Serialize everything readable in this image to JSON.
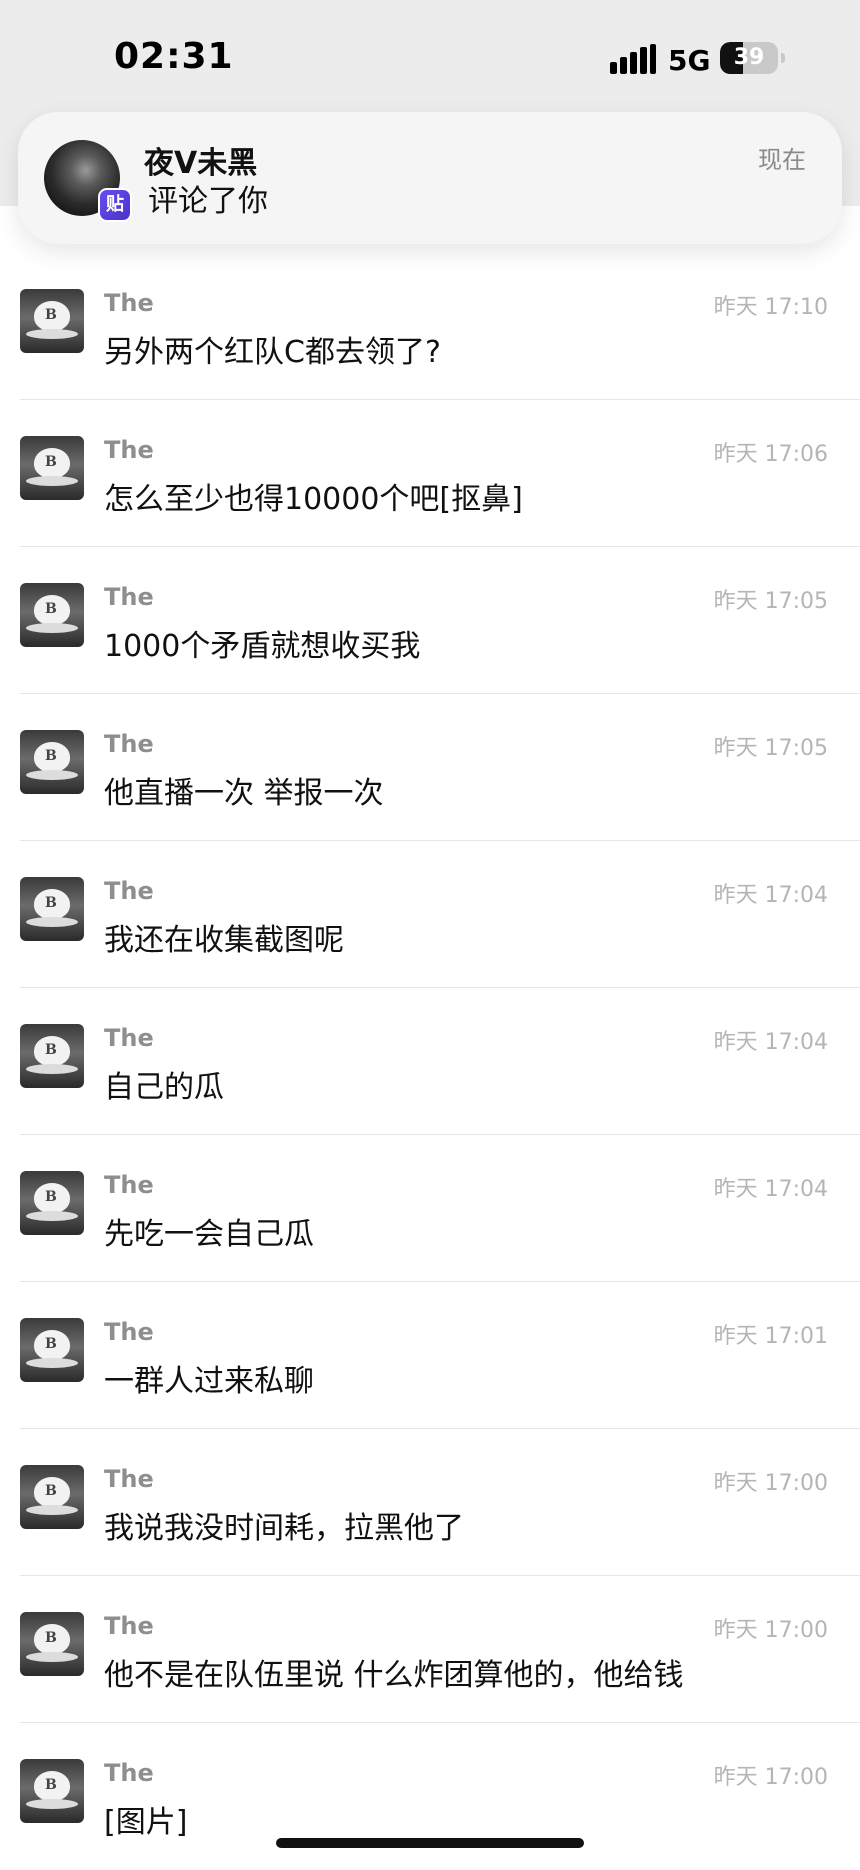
{
  "status_bar": {
    "time": "02:31",
    "network": "5G",
    "battery": "39",
    "battery_level": 0.39,
    "icons": [
      "signal-icon",
      "battery-icon"
    ]
  },
  "notification": {
    "title": "夜Ⅴ未黑",
    "body": "评论了你",
    "time": "现在",
    "app_badge": "贴"
  },
  "messages": [
    {
      "name": "The",
      "time": "昨天 17:10",
      "text": "另外两个红队C都去领了?"
    },
    {
      "name": "The",
      "time": "昨天 17:06",
      "text": "怎么至少也得10000个吧[抠鼻]"
    },
    {
      "name": "The",
      "time": "昨天 17:05",
      "text": "1000个矛盾就想收买我"
    },
    {
      "name": "The",
      "time": "昨天 17:05",
      "text": "他直播一次 举报一次"
    },
    {
      "name": "The",
      "time": "昨天 17:04",
      "text": "我还在收集截图呢"
    },
    {
      "name": "The",
      "time": "昨天 17:04",
      "text": "自己的瓜"
    },
    {
      "name": "The",
      "time": "昨天 17:04",
      "text": "先吃一会自己瓜"
    },
    {
      "name": "The",
      "time": "昨天 17:01",
      "text": "一群人过来私聊"
    },
    {
      "name": "The",
      "time": "昨天 17:00",
      "text": "我说我没时间耗，拉黑他了"
    },
    {
      "name": "The",
      "time": "昨天 17:00",
      "text": "他不是在队伍里说 什么炸团算他的，他给钱"
    },
    {
      "name": "The",
      "time": "昨天 17:00",
      "text": "[图片]"
    }
  ]
}
